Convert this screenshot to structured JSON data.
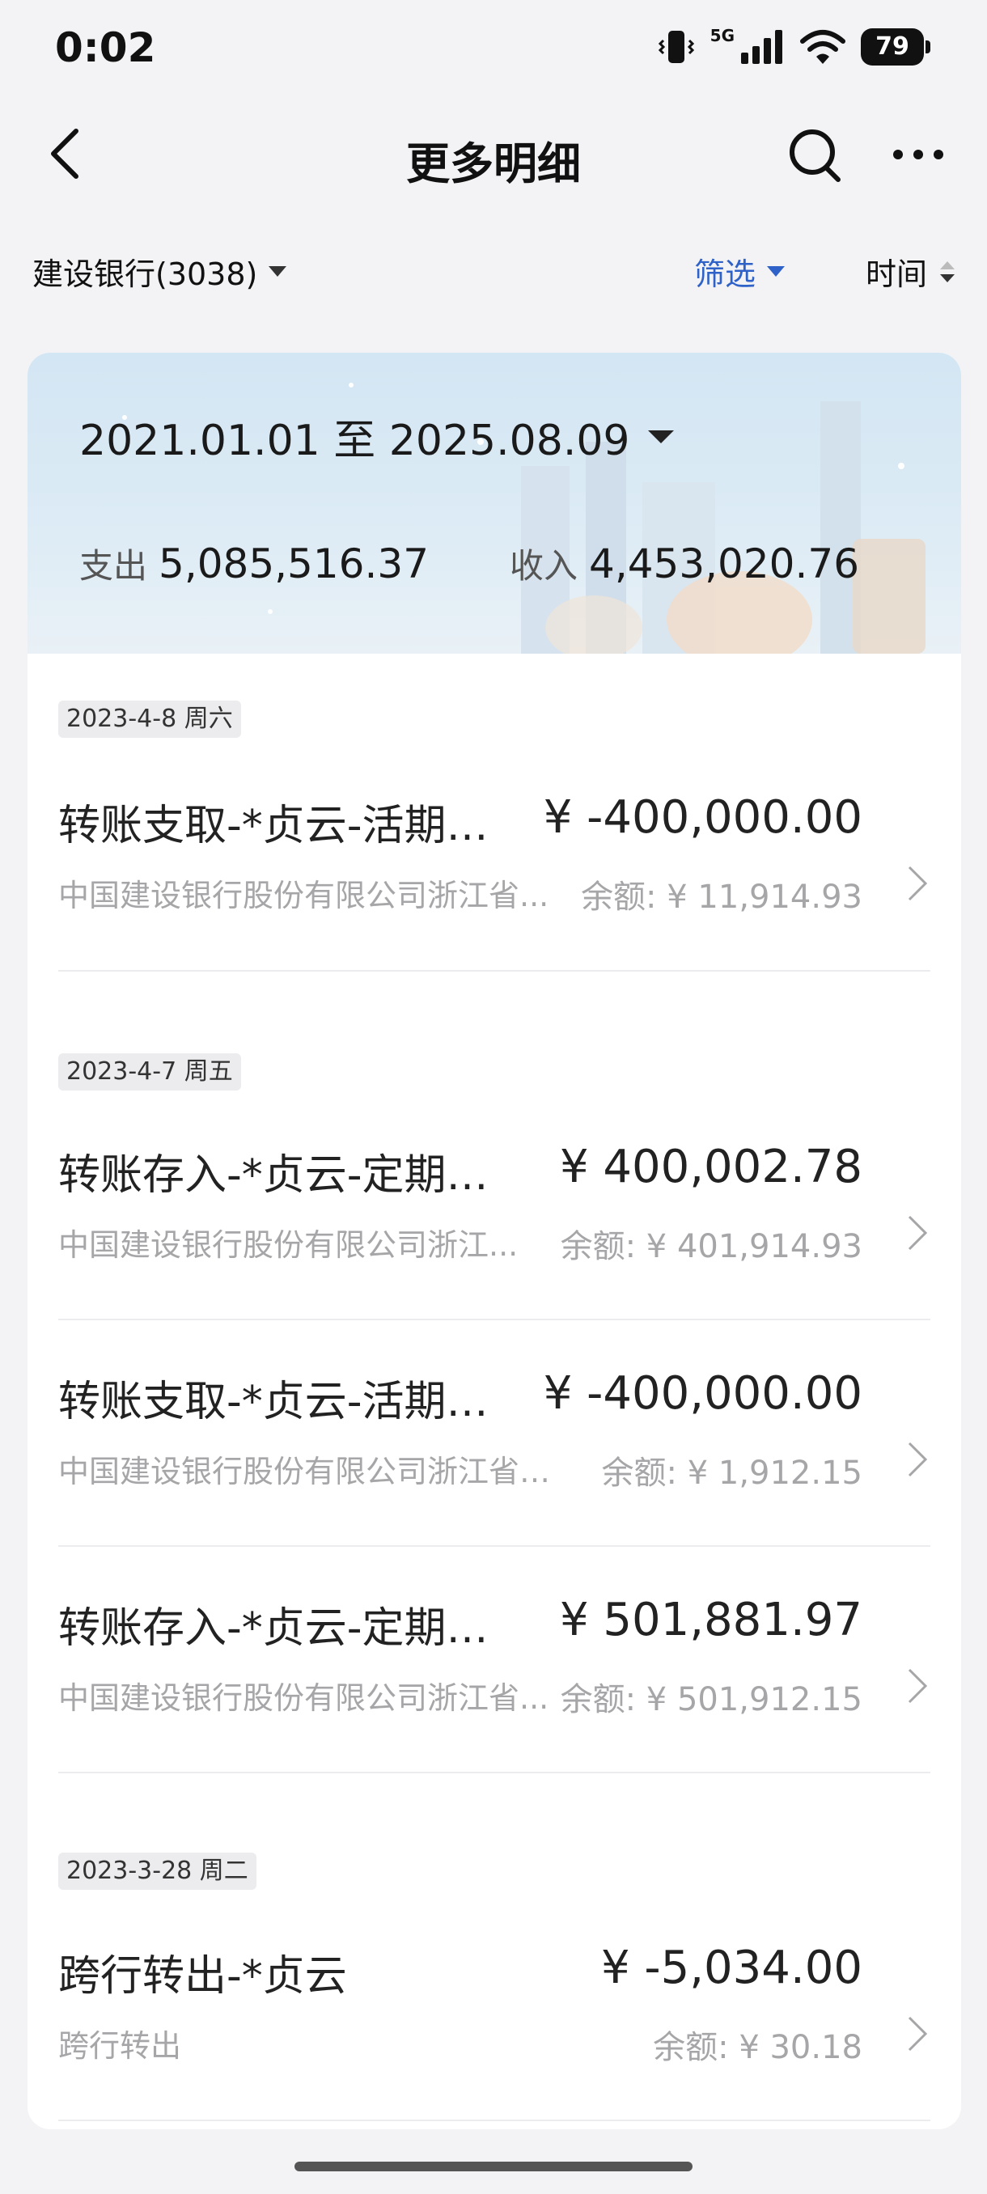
{
  "status_bar": {
    "time": "0:02",
    "network": "5G",
    "battery": "79"
  },
  "nav": {
    "title": "更多明细"
  },
  "filters": {
    "account": "建设银行(3038)",
    "filter_label": "筛选",
    "sort_label": "时间"
  },
  "summary": {
    "date_range": "2021.01.01 至 2025.08.09",
    "expense_label": "支出",
    "expense_value": "5,085,516.37",
    "income_label": "收入",
    "income_value": "4,453,020.76"
  },
  "groups": [
    {
      "date": "2023-4-8 周六"
    },
    {
      "date": "2023-4-7 周五"
    },
    {
      "date": "2023-3-28 周二"
    }
  ],
  "transactions": [
    {
      "title": "转账支取-*贞云-活期转...",
      "amount": "¥ -400,000.00",
      "bank": "中国建设银行股份有限公司浙江省...",
      "balance": "余额: ¥ 11,914.93"
    },
    {
      "title": "转账存入-*贞云-定期转...",
      "amount": "¥ 400,002.78",
      "bank": "中国建设银行股份有限公司浙江...",
      "balance": "余额: ¥ 401,914.93"
    },
    {
      "title": "转账支取-*贞云-活期转...",
      "amount": "¥ -400,000.00",
      "bank": "中国建设银行股份有限公司浙江省分...",
      "balance": "余额: ¥ 1,912.15"
    },
    {
      "title": "转账存入-*贞云-定期转活期",
      "amount": "¥ 501,881.97",
      "bank": "中国建设银行股份有限公司浙江省...",
      "balance": "余额: ¥ 501,912.15"
    },
    {
      "title": "跨行转出-*贞云",
      "amount": "¥ -5,034.00",
      "bank": "跨行转出",
      "balance": "余额: ¥ 30.18"
    }
  ],
  "colors": {
    "accent": "#2f62c8",
    "muted_text": "#a6a6a8",
    "background": "#f3f3f5"
  },
  "icons": [
    "back-icon",
    "search-icon",
    "more-icon",
    "chevron-down-icon",
    "sort-icon",
    "chevron-right-icon",
    "vibrate-icon",
    "signal-icon",
    "wifi-icon",
    "battery-icon"
  ]
}
